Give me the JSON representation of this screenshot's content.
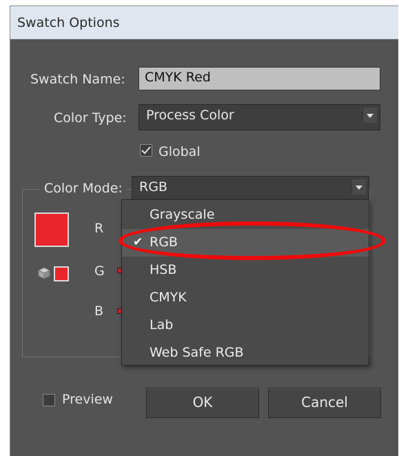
{
  "window": {
    "title": "Swatch Options"
  },
  "form": {
    "swatch_name_label": "Swatch Name:",
    "swatch_name_value": "CMYK Red",
    "color_type_label": "Color Type:",
    "color_type_value": "Process Color",
    "global_label": "Global",
    "global_checked": true,
    "color_mode_label": "Color Mode:",
    "color_mode_value": "RGB"
  },
  "channels": {
    "r": "R",
    "g": "G",
    "b": "B"
  },
  "swatch_color": "#e8262b",
  "menu": {
    "items": [
      {
        "label": "Grayscale",
        "checked": false
      },
      {
        "label": "RGB",
        "checked": true
      },
      {
        "label": "HSB",
        "checked": false
      },
      {
        "label": "CMYK",
        "checked": false
      },
      {
        "label": "Lab",
        "checked": false
      },
      {
        "label": "Web Safe RGB",
        "checked": false
      }
    ],
    "check_glyph": "✔"
  },
  "highlight_color": "#ee0b0b",
  "footer": {
    "preview_label": "Preview",
    "preview_checked": false,
    "ok_label": "OK",
    "cancel_label": "Cancel"
  }
}
